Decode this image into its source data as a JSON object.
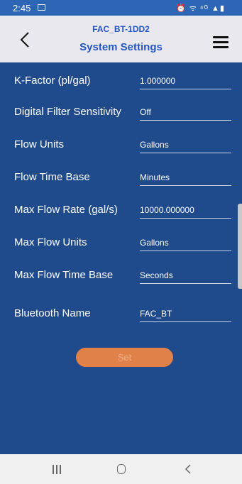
{
  "status_bar": {
    "time": "2:45",
    "right_icons": "⏰ ᯤ ⁴ᴳ ▲▮"
  },
  "header": {
    "device_name": "FAC_BT-1DD2",
    "title": "System Settings"
  },
  "settings": [
    {
      "label": "K-Factor (pl/gal)",
      "value": "1.000000"
    },
    {
      "label": "Digital Filter Sensitivity",
      "value": "Off"
    },
    {
      "label": "Flow Units",
      "value": "Gallons"
    },
    {
      "label": "Flow Time Base",
      "value": "Minutes"
    },
    {
      "label": "Max Flow Rate (gal/s)",
      "value": "10000.000000"
    },
    {
      "label": "Max Flow Units",
      "value": "Gallons"
    },
    {
      "label": "Max Flow Time Base",
      "value": "Seconds"
    },
    {
      "label": "Bluetooth Name",
      "value": "FAC_BT"
    }
  ],
  "set_button_label": "Set",
  "colors": {
    "background": "#1f4a8c",
    "header_bg": "#e8e8ee",
    "accent": "#2457c5",
    "button": "#e0814a"
  }
}
